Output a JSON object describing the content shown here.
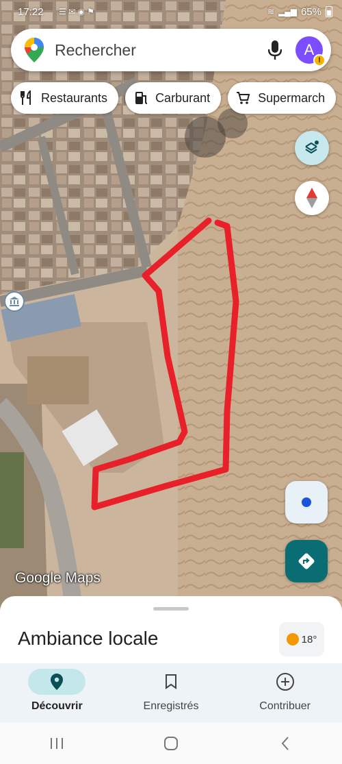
{
  "status_bar": {
    "time": "17:22",
    "battery": "65%",
    "icons": [
      "notification-icons",
      "wifi-icon",
      "signal-icon",
      "battery-icon"
    ]
  },
  "search": {
    "placeholder": "Rechercher",
    "account_initial": "A"
  },
  "chips": [
    {
      "label": "Restaurants",
      "icon": "restaurant-icon"
    },
    {
      "label": "Carburant",
      "icon": "fuel-icon"
    },
    {
      "label": "Supermarch",
      "icon": "cart-icon"
    }
  ],
  "map": {
    "watermark": "Google Maps",
    "outline_color": "#e8202a",
    "imagery": "satellite"
  },
  "sheet": {
    "title": "Ambiance locale",
    "weather": "18°"
  },
  "nav": [
    {
      "label": "Découvrir",
      "icon": "place-icon",
      "active": true
    },
    {
      "label": "Enregistrés",
      "icon": "bookmark-icon",
      "active": false
    },
    {
      "label": "Contribuer",
      "icon": "add-circle-icon",
      "active": false
    }
  ],
  "colors": {
    "accent": "#0b6d74",
    "active_pill": "#c4e7ec",
    "avatar": "#7c4dff"
  }
}
